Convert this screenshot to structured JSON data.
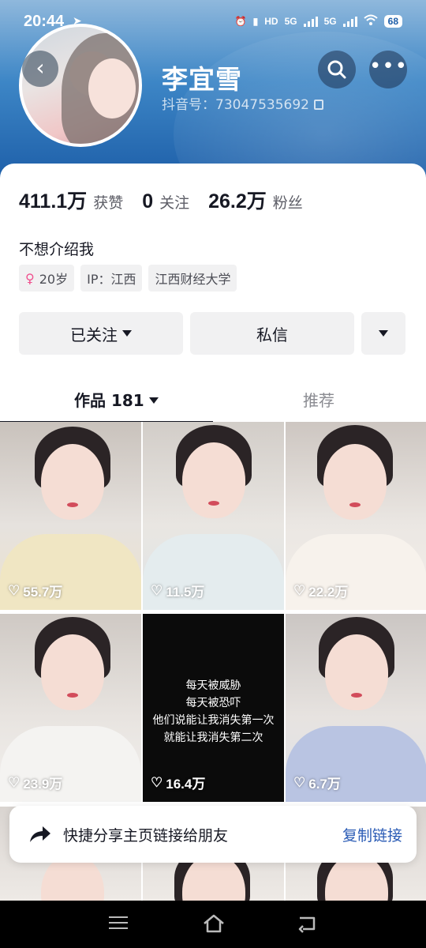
{
  "status_bar": {
    "time": "20:44",
    "network_labels": [
      "HD",
      "5G",
      "5G"
    ],
    "battery": "68"
  },
  "profile": {
    "name": "李宜雪",
    "douyin_id": "抖音号：73047535692",
    "bio": "不想介绍我",
    "tags": {
      "age": "20岁",
      "ip": "IP：江西",
      "school": "江西财经大学"
    }
  },
  "stats": {
    "likes_value": "411.1万",
    "likes_label": "获赞",
    "following_value": "0",
    "following_label": "关注",
    "followers_value": "26.2万",
    "followers_label": "粉丝"
  },
  "actions": {
    "follow_label": "已关注",
    "message_label": "私信"
  },
  "tabs": {
    "works": "作品 181",
    "recommend": "推荐"
  },
  "videos": [
    {
      "likes": "55.7万"
    },
    {
      "likes": "11.5万"
    },
    {
      "likes": "22.2万"
    },
    {
      "likes": "23.9万"
    },
    {
      "likes": "16.4万",
      "caption": [
        "每天被威胁",
        "每天被恐吓",
        "他们说能让我消失第一次",
        "就能让我消失第二次"
      ]
    },
    {
      "likes": "6.7万"
    }
  ],
  "share": {
    "text": "快捷分享主页链接给朋友",
    "link": "复制链接"
  },
  "icons": [
    "back-icon",
    "search-icon",
    "more-icon",
    "copy-icon",
    "female-icon",
    "chevron-down-icon",
    "heart-icon",
    "share-arrow-icon",
    "menu-icon",
    "home-icon",
    "back-nav-icon"
  ],
  "colors": {
    "header_top": "#8fb8dc",
    "header_bottom": "#1d5ea8",
    "link": "#2a5bb5",
    "female": "#f0508e"
  }
}
